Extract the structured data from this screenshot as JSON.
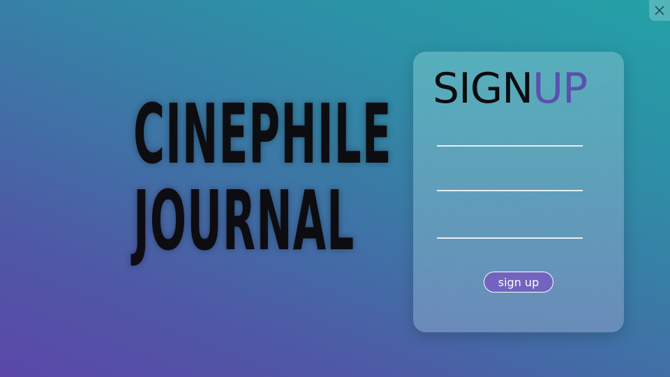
{
  "window": {
    "close_icon": "close-icon"
  },
  "brand": {
    "line1": "CINEPHILE",
    "line2": "JOURNAL"
  },
  "signup_card": {
    "title_part1": "SIGN",
    "title_part2": "UP",
    "fields": [
      {
        "value": "",
        "placeholder": ""
      },
      {
        "value": "",
        "placeholder": ""
      },
      {
        "value": "",
        "placeholder": ""
      }
    ],
    "submit_label": "sign up"
  },
  "colors": {
    "background_start": "#5a47a8",
    "background_end": "#23a1a6",
    "title_accent": "#5d4fae",
    "button_fill": "#7264be",
    "brand_text": "#0d0c10"
  }
}
